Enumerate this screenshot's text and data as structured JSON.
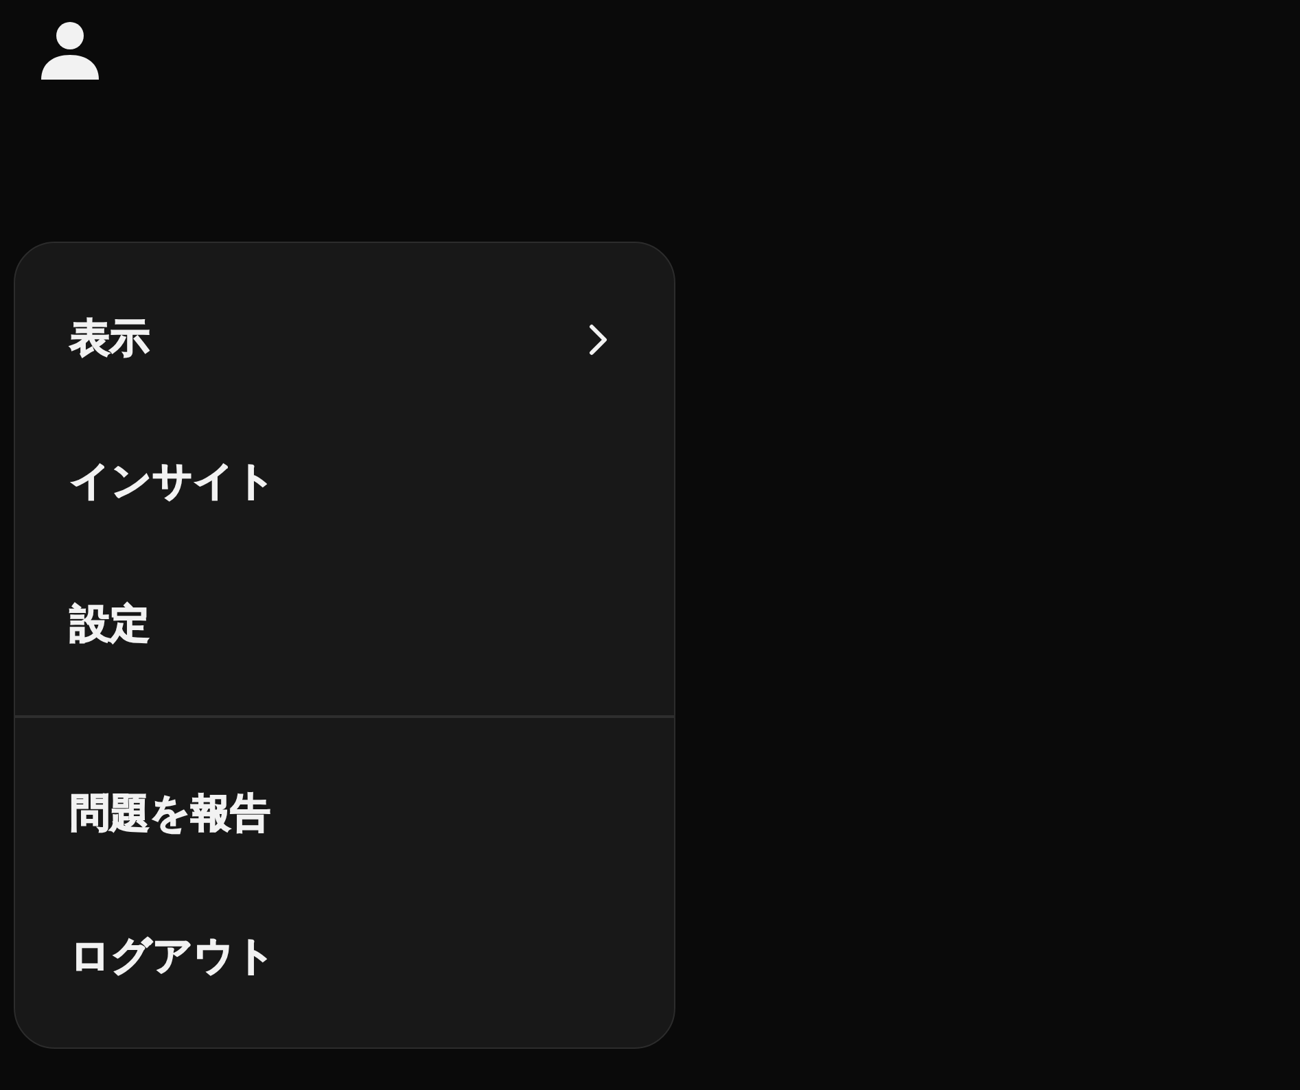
{
  "menu": {
    "groups": [
      {
        "items": [
          {
            "label": "表示",
            "submenu": true
          },
          {
            "label": "インサイト",
            "submenu": false
          },
          {
            "label": "設定",
            "submenu": false
          }
        ]
      },
      {
        "items": [
          {
            "label": "問題を報告",
            "submenu": false
          },
          {
            "label": "ログアウト",
            "submenu": false
          }
        ]
      }
    ]
  }
}
